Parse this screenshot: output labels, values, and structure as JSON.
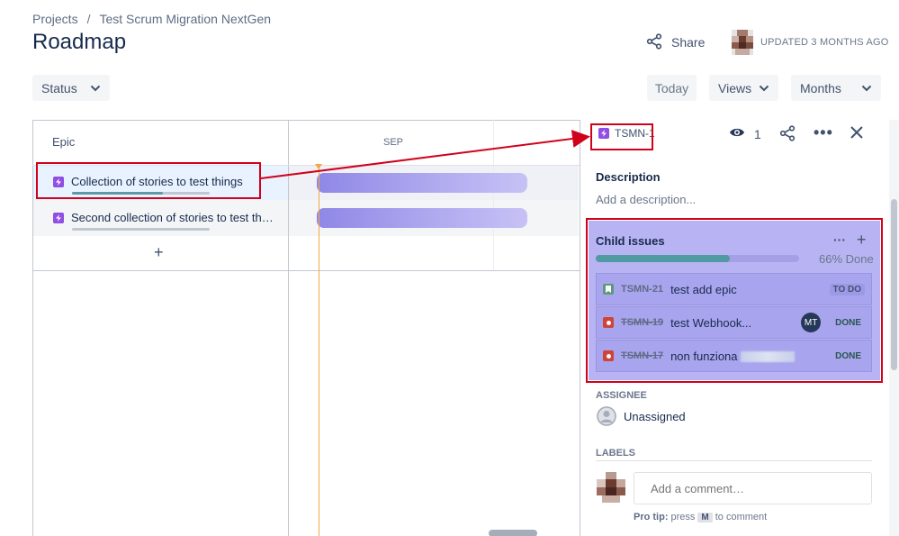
{
  "breadcrumb": {
    "projects": "Projects",
    "separator": "/",
    "project": "Test Scrum Migration NextGen"
  },
  "page": {
    "title": "Roadmap"
  },
  "header": {
    "share_label": "Share",
    "updated": "UPDATED 3 MONTHS AGO"
  },
  "toolbar": {
    "status_label": "Status",
    "today_label": "Today",
    "views_label": "Views",
    "months_label": "Months"
  },
  "roadmap": {
    "epic_header": "Epic",
    "month_label": "SEP",
    "epics": [
      {
        "title": "Collection of stories to test things",
        "progress": 0.66
      },
      {
        "title": "Second collection of stories to test th…",
        "progress": 0.0
      }
    ],
    "add_label": "+"
  },
  "panel": {
    "issue_key": "TSMN-1",
    "watch_count": "1",
    "description_title": "Description",
    "description_placeholder": "Add a description...",
    "child_issues_title": "Child issues",
    "child_progress": 0.66,
    "child_done_label": "66% Done",
    "children": [
      {
        "key": "TSMN-21",
        "summary": "test add epic",
        "status": "TO DO",
        "type": "story",
        "done": false
      },
      {
        "key": "TSMN-19",
        "summary": "test Webhook...",
        "status": "DONE",
        "type": "bug",
        "done": true,
        "assignee": "MT"
      },
      {
        "key": "TSMN-17",
        "summary": "non funziona",
        "status": "DONE",
        "type": "bug",
        "done": true
      }
    ],
    "assignee_label": "ASSIGNEE",
    "assignee_value": "Unassigned",
    "labels_label": "LABELS",
    "comment_placeholder": "Add a comment…",
    "protip_bold": "Pro tip:",
    "protip_text1": "press",
    "protip_key": "M",
    "protip_text2": "to comment"
  },
  "colors": {
    "annotation": "#d0021b",
    "epic": "#904ee2",
    "today": "#f5a742",
    "bar": "#8f87e6"
  }
}
